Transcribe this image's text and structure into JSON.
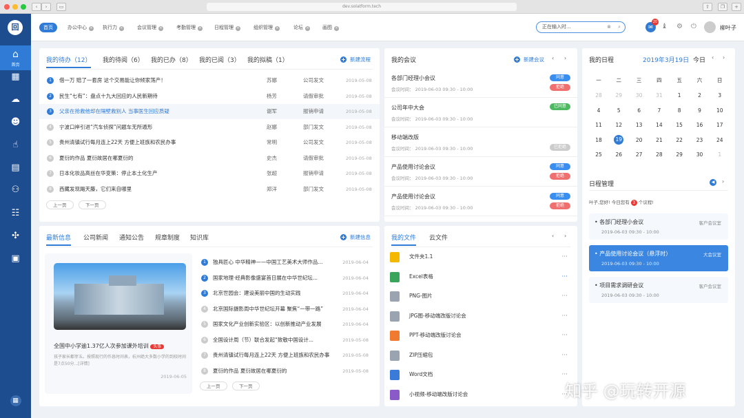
{
  "browser": {
    "url": "dev.solatform.tech"
  },
  "sidebar": {
    "logo": "回",
    "home_label": "首页",
    "icons": [
      "building-icon",
      "cloud-icon",
      "users-icon",
      "hand-icon",
      "calendar-icon",
      "org-icon",
      "group-icon",
      "tools-icon",
      "monitor-icon"
    ],
    "bottom_icon": "grid-icon"
  },
  "topnav": {
    "tabs": [
      "首页",
      "办公中心",
      "执行力",
      "会议管理",
      "考勤管理",
      "日程管理",
      "组织管理",
      "论坛",
      "画图"
    ],
    "search_value": "正在输入时...",
    "message_count": "20",
    "user": "柳叶子"
  },
  "todo": {
    "tabs": [
      "我的待办（12）",
      "我的待阅（6）",
      "我的已办（8）",
      "我的已阅（3）",
      "我的拟稿（1）"
    ],
    "new_label": "新建流程",
    "rows": [
      {
        "n": "1",
        "title": "借一万 赔了一套房 这个交易能让你倾家荡产！",
        "user": "苏娜",
        "type": "公司发文",
        "date": "2019-05-08"
      },
      {
        "n": "2",
        "title": "民生“七有”：盘点十九大回应的人民新期待",
        "user": "杨芳",
        "type": "请假审批",
        "date": "2019-05-08"
      },
      {
        "n": "3",
        "title": "父亲在抢救他却在隔壁救别人 当事医生回应质疑",
        "user": "谢军",
        "type": "报销申请",
        "date": "2019-05-08"
      },
      {
        "n": "4",
        "title": "宁波口岸引进“汽车侦探”问题车无所遁形",
        "user": "赵娜",
        "type": "部门发文",
        "date": "2019-05-08"
      },
      {
        "n": "5",
        "title": "贵州清镇试行每月连上22天 方便上班族和农民办事",
        "user": "常明",
        "type": "公司发文",
        "date": "2019-05-08"
      },
      {
        "n": "6",
        "title": "夏衍的作品 夏衍故居在哪夏衍的",
        "user": "史杰",
        "type": "请假审批",
        "date": "2019-05-08"
      },
      {
        "n": "7",
        "title": "日本化妆品高丝在华变策：停止本土化生产",
        "user": "张超",
        "type": "报销申请",
        "date": "2019-05-08"
      },
      {
        "n": "8",
        "title": "西藏发现飓天藤，它们来自哪里",
        "user": "郑洋",
        "type": "部门发文",
        "date": "2019-05-08"
      }
    ],
    "prev": "上一页",
    "next": "下一页"
  },
  "meetings": {
    "title": "我的会议",
    "new_label": "新建会议",
    "items": [
      {
        "title": "各部门经理小会议",
        "time": "会议时间：  2019-06-03   09:30 - 10:00",
        "badges": [
          {
            "t": "同意",
            "c": "#3a8ef0"
          },
          {
            "t": "拒绝",
            "c": "#f07070"
          }
        ]
      },
      {
        "title": "公司年中大会",
        "time": "会议时间：  2019-06-03   09:30 - 10:00",
        "badges": [
          {
            "t": "已同意",
            "c": "#4cb860"
          }
        ]
      },
      {
        "title": "移动端改版",
        "time": "会议时间：  2019-06-03   09:30 - 10:00",
        "badges": [
          {
            "t": "已拒绝",
            "c": "#cccccc"
          }
        ]
      },
      {
        "title": "产品使用讨论会议",
        "time": "会议时间：  2019-06-03   09:30 - 10:00",
        "badges": [
          {
            "t": "同意",
            "c": "#3a8ef0"
          },
          {
            "t": "拒绝",
            "c": "#f07070"
          }
        ]
      },
      {
        "title": "产品使用讨论会议",
        "time": "会议时间：  2019-06-03   09:30 - 10:00",
        "badges": [
          {
            "t": "同意",
            "c": "#3a8ef0"
          },
          {
            "t": "拒绝",
            "c": "#f07070"
          }
        ]
      }
    ]
  },
  "calendar": {
    "title": "我的日程",
    "month": "2019年3月19日",
    "today": "今日",
    "weekdays": [
      "一",
      "二",
      "三",
      "四",
      "五",
      "六",
      "日"
    ],
    "days": [
      "28",
      "29",
      "30",
      "31",
      "1",
      "2",
      "3",
      "4",
      "5",
      "6",
      "7",
      "8",
      "9",
      "10",
      "11",
      "12",
      "13",
      "14",
      "15",
      "16",
      "17",
      "18",
      "19",
      "20",
      "21",
      "22",
      "23",
      "24",
      "25",
      "26",
      "27",
      "28",
      "29",
      "30",
      "1"
    ],
    "selected": "19"
  },
  "schedule": {
    "title": "日程管理",
    "greet_pre": "叶子,您好! 今日您有",
    "count": "3",
    "greet_post": "个议程!",
    "items": [
      {
        "title": "各部门经理小会议",
        "time": "2019-06-03   09:30 - 10:00",
        "room": "客户会议室"
      },
      {
        "title": "产品使用讨论会议（悬浮时）",
        "time": "2019-06-03   09:30 - 10:00",
        "room": "大会议室"
      },
      {
        "title": "项目需求调研会议",
        "time": "2019-06-03   09:30 - 10:00",
        "room": "客户会议室"
      }
    ]
  },
  "news": {
    "tabs": [
      "最新信息",
      "公司新闻",
      "通知公告",
      "规章制度",
      "知识库"
    ],
    "new_label": "新建信息",
    "feature": {
      "title": "全国中小学逾1.37亿人次参加课外培训",
      "tag": "头条",
      "desc": "孩子家长都宰五。按照现行的作息时间表，杭州绝大多数小学的到校时间是7点50分...[详情]",
      "date": "2019-06-05"
    },
    "rows": [
      {
        "n": "1",
        "title": "独具匠心 中华精神——中国工艺美术大师作品...",
        "date": "2019-06-04"
      },
      {
        "n": "2",
        "title": "国家地理·经典影像盛宴首日展在中华世纪坛...",
        "date": "2019-06-04"
      },
      {
        "n": "3",
        "title": "北京世园会：建设美丽中国的生动实践",
        "date": "2019-06-04"
      },
      {
        "n": "4",
        "title": "北京国际摄影周中华世纪坛开幕 聚焦“一带一路”",
        "date": "2019-06-04"
      },
      {
        "n": "5",
        "title": "国家文化产业创新实验区：以创新推动产业发展",
        "date": "2019-06-04"
      },
      {
        "n": "6",
        "title": "全国设计周（节）联合发起“致敬中国设计...",
        "date": "2019-05-08"
      },
      {
        "n": "7",
        "title": "贵州清镇试行每月连上22天 方便上班族和农民办事",
        "date": "2019-05-08"
      },
      {
        "n": "8",
        "title": "夏衍的作品 夏衍故居在哪夏衍的",
        "date": "2019-05-08"
      }
    ],
    "prev": "上一页",
    "next": "下一页"
  },
  "files": {
    "tabs": [
      "我的文件",
      "云文件"
    ],
    "items": [
      {
        "name": "文件夹1.1",
        "icon": "folder-icon",
        "color": "#f5b800"
      },
      {
        "name": "Excel表格",
        "icon": "excel-icon",
        "color": "#3aa55a"
      },
      {
        "name": "PNG-图片",
        "icon": "png-icon",
        "color": "#9aa4b0"
      },
      {
        "name": "JPG图-移动端改版讨论会",
        "icon": "jpg-icon",
        "color": "#9aa4b0"
      },
      {
        "name": "PPT-移动端改版讨论会",
        "icon": "ppt-icon",
        "color": "#f07a30"
      },
      {
        "name": "ZIP压缩包",
        "icon": "zip-icon",
        "color": "#9aa4b0"
      },
      {
        "name": "Word文档",
        "icon": "word-icon",
        "color": "#3a7ad8"
      },
      {
        "name": "小视频-移动端改版讨论会",
        "icon": "video-icon",
        "color": "#8a5ac8"
      }
    ]
  },
  "watermark": "知乎 @玩转开源",
  "colors": {
    "accent": "#2f7bd6",
    "sidebar": "#1d4d8f"
  }
}
